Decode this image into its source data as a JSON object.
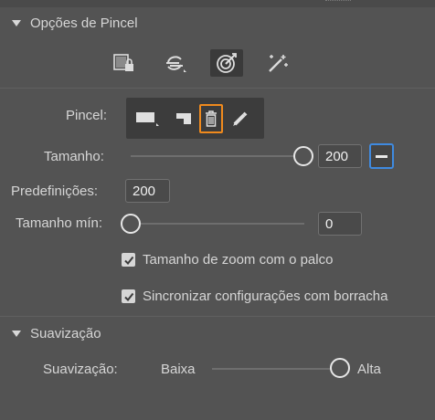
{
  "sections": {
    "brush_options": {
      "title": "Opções de Pincel"
    },
    "smoothing": {
      "title": "Suavização"
    }
  },
  "mode_icons": [
    "lock-fill-icon",
    "stroke-sync-icon",
    "target-brush-icon",
    "magic-wand-icon"
  ],
  "brush": {
    "label": "Pincel:",
    "tools": [
      "rectangle-brush-icon",
      "angled-brush-icon",
      "trash-icon",
      "pencil-icon"
    ]
  },
  "size": {
    "label": "Tamanho:",
    "value": "200",
    "slider_fraction": 1.0
  },
  "presets": {
    "label": "Predefinições:",
    "value": "200"
  },
  "min_size": {
    "label": "Tamanho mín:",
    "value": "0",
    "slider_fraction": 0.0
  },
  "checkboxes": [
    {
      "label": "Tamanho de zoom com o palco",
      "checked": true
    },
    {
      "label": "Sincronizar configurações com borracha",
      "checked": true
    }
  ],
  "smoothing": {
    "label": "Suavização:",
    "low": "Baixa",
    "high": "Alta",
    "slider_fraction": 1.0
  },
  "colors": {
    "panel": "#535353",
    "highlight": "#f08a1d",
    "focus": "#3f8ae0"
  }
}
